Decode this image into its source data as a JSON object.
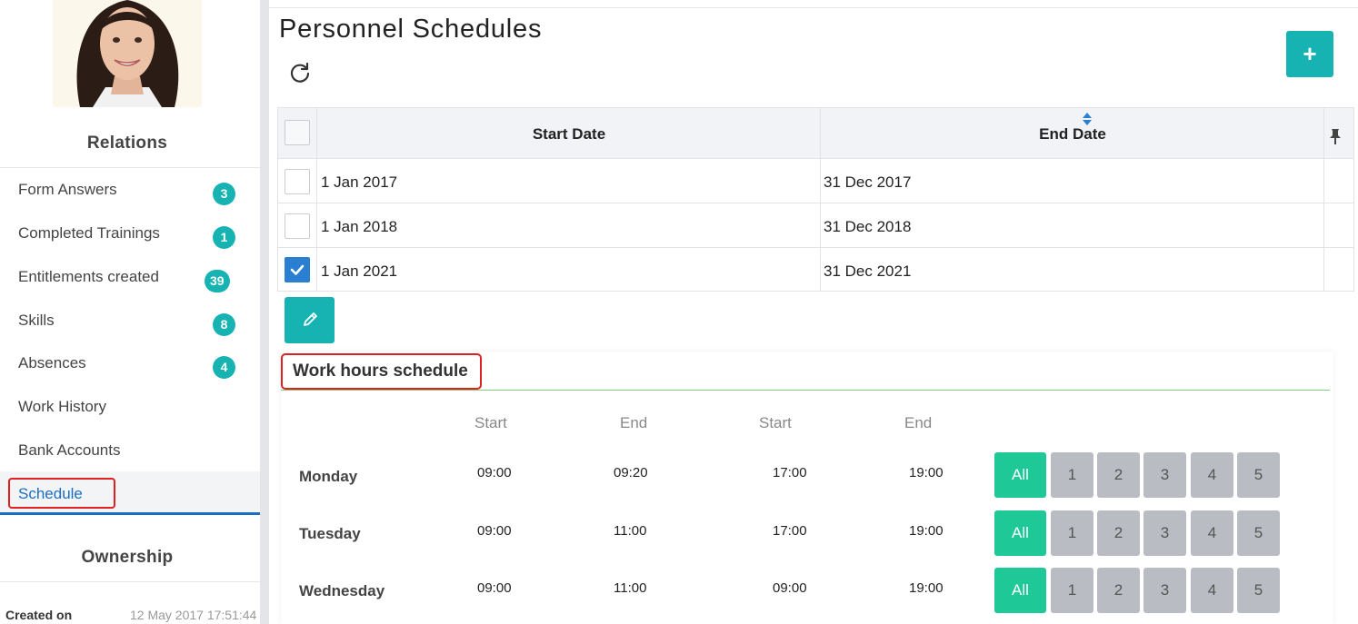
{
  "sidebar": {
    "relations_title": "Relations",
    "relations": [
      {
        "label": "Form Answers",
        "count": "3"
      },
      {
        "label": "Completed Trainings",
        "count": "1"
      },
      {
        "label": "Entitlements created",
        "count": "39"
      },
      {
        "label": "Skills",
        "count": "8"
      },
      {
        "label": "Absences",
        "count": "4"
      },
      {
        "label": "Work History",
        "count": null
      },
      {
        "label": "Bank Accounts",
        "count": null
      },
      {
        "label": "Schedule",
        "count": null
      }
    ],
    "active_item": "Schedule",
    "ownership_title": "Ownership",
    "created_label": "Created on",
    "created_value": "12 May 2017 17:51:44"
  },
  "main": {
    "title": "Personnel Schedules",
    "add_icon": "+",
    "table": {
      "columns": [
        "Start Date",
        "End Date"
      ],
      "rows": [
        {
          "start": "1 Jan 2017",
          "end": "31 Dec 2017",
          "checked": false
        },
        {
          "start": "1 Jan 2018",
          "end": "31 Dec 2018",
          "checked": false
        },
        {
          "start": "1 Jan 2021",
          "end": "31 Dec 2021",
          "checked": true
        }
      ]
    },
    "work_hours": {
      "title": "Work hours schedule",
      "col_headers": [
        "Start",
        "End",
        "Start",
        "End"
      ],
      "week_buttons": [
        "All",
        "1",
        "2",
        "3",
        "4",
        "5"
      ],
      "days": [
        {
          "day": "Monday",
          "times": [
            "09:00",
            "09:20",
            "17:00",
            "19:00"
          ]
        },
        {
          "day": "Tuesday",
          "times": [
            "09:00",
            "11:00",
            "17:00",
            "19:00"
          ]
        },
        {
          "day": "Wednesday",
          "times": [
            "09:00",
            "11:00",
            "09:00",
            "19:00"
          ]
        }
      ]
    }
  },
  "colors": {
    "teal": "#17b3b3",
    "active_blue": "#1a6fc4",
    "all_green": "#1ec997",
    "week_gray": "#b9bcc2",
    "highlight_red": "#e02020"
  }
}
